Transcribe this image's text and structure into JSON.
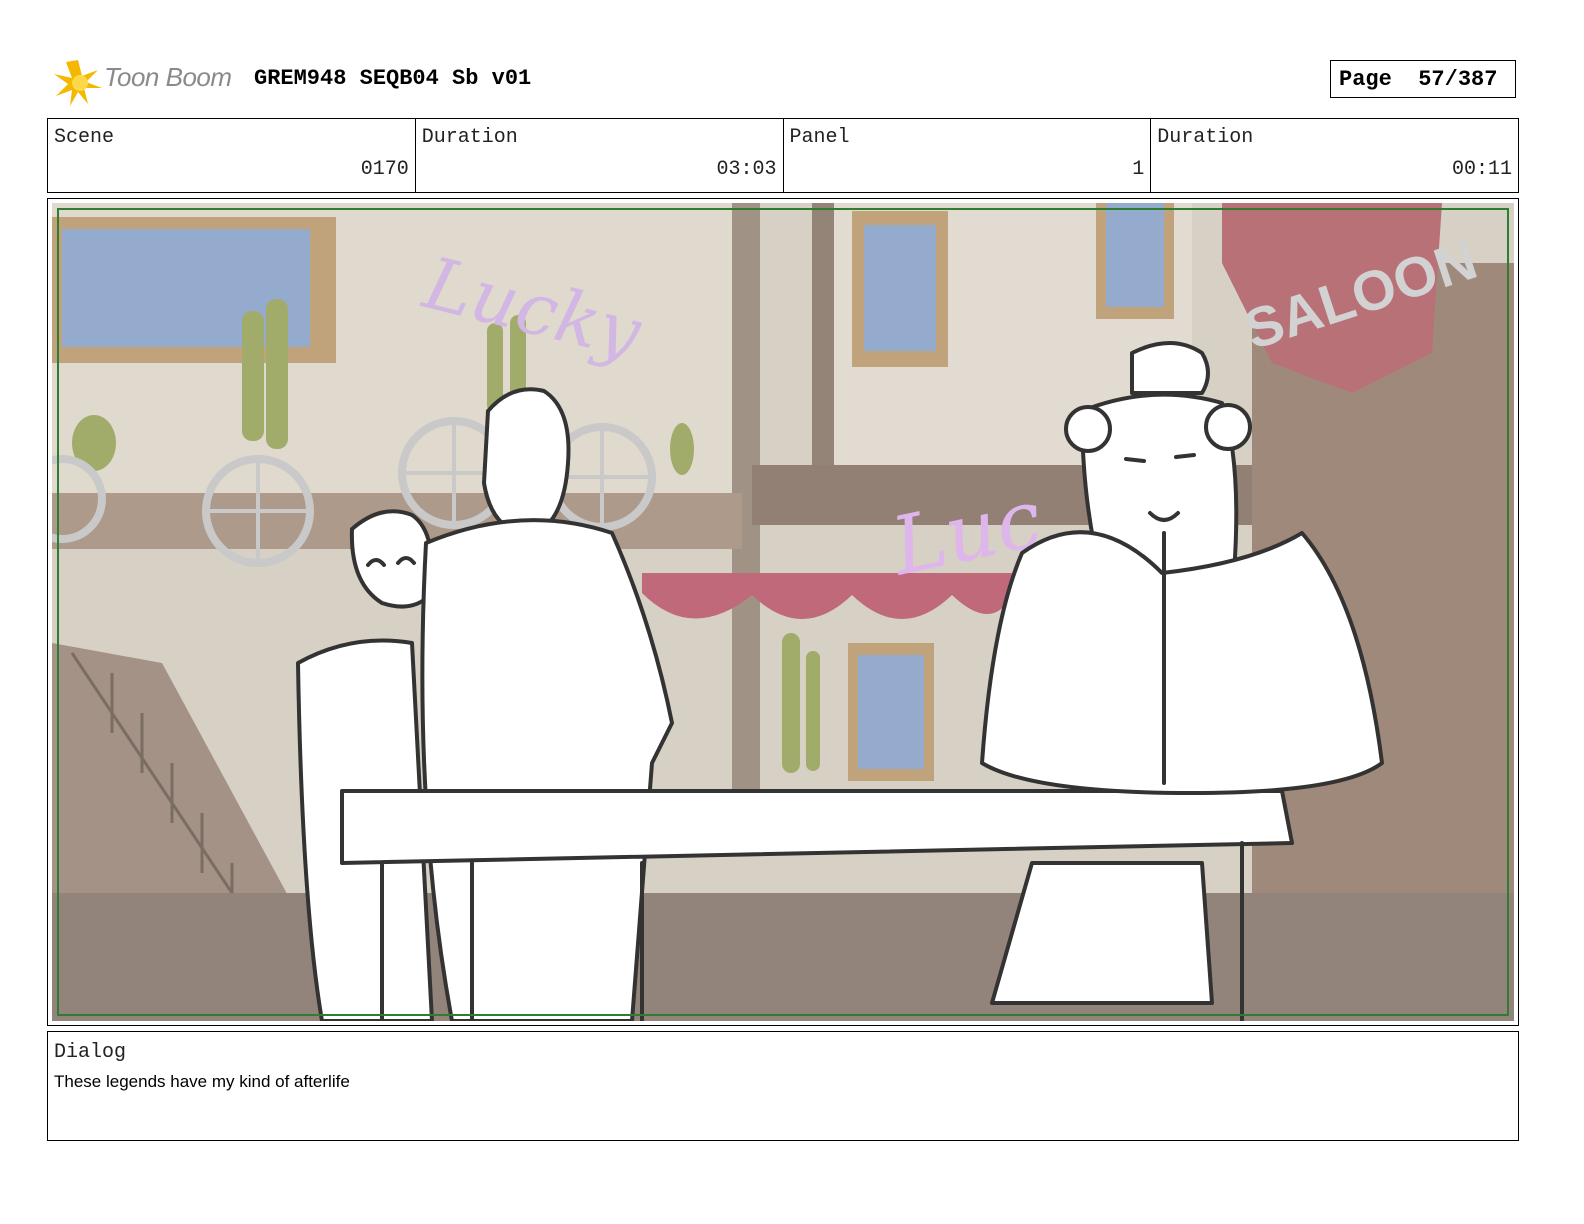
{
  "header": {
    "logo_text": "Toon Boom",
    "doc_title": "GREM948 SEQB04 Sb v01",
    "page_label": "Page",
    "page_value": "57/387"
  },
  "info": {
    "scene_label": "Scene",
    "scene_value": "0170",
    "duration_label": "Duration",
    "duration_value": "03:03",
    "panel_label": "Panel",
    "panel_value": "1",
    "panel_duration_label": "Duration",
    "panel_duration_value": "00:11"
  },
  "panel": {
    "sign_lucky_upper": "Lucky",
    "sign_lucky_lower": "Luc",
    "sign_saloon": "SALOON"
  },
  "dialog": {
    "label": "Dialog",
    "text": "These legends have my kind of afterlife"
  }
}
